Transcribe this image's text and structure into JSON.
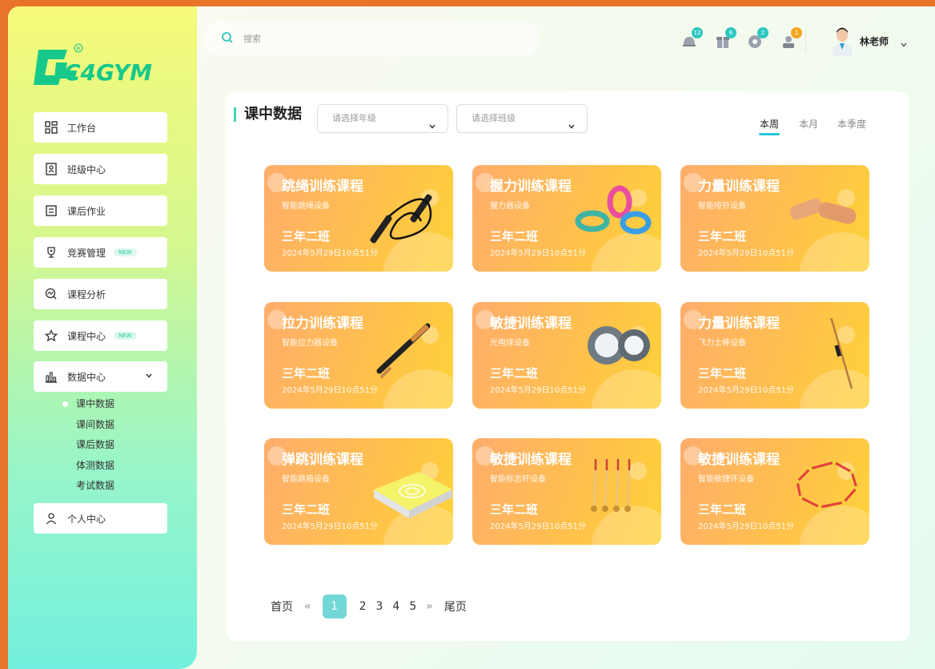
{
  "app": {
    "logo_text": "C4GYM",
    "logo_mark": "®"
  },
  "sidebar": {
    "items": [
      {
        "label": "工作台",
        "icon": "dashboard-icon"
      },
      {
        "label": "班级中心",
        "icon": "class-icon"
      },
      {
        "label": "课后作业",
        "icon": "homework-icon"
      },
      {
        "label": "竞赛管理",
        "icon": "trophy-icon",
        "badge": "NEW"
      },
      {
        "label": "课程分析",
        "icon": "analysis-icon"
      },
      {
        "label": "课程中心",
        "icon": "star-icon",
        "badge": "NEW"
      },
      {
        "label": "数据中心",
        "icon": "bar-chart-icon"
      },
      {
        "label": "个人中心",
        "icon": "user-icon"
      }
    ],
    "data_sub_items": [
      "课中数据",
      "课间数据",
      "课后数据",
      "体测数据",
      "考试数据"
    ]
  },
  "header": {
    "search_placeholder": "搜索",
    "notifications": [
      {
        "icon": "bell-icon",
        "count": "12",
        "color": "#2fc7c0"
      },
      {
        "icon": "gift-icon",
        "count": "8",
        "color": "#2fc7c0"
      },
      {
        "icon": "message-icon",
        "count": "2",
        "color": "#2fc7c0"
      },
      {
        "icon": "team-icon",
        "count": "1",
        "color": "#f5a623"
      }
    ],
    "user_name": "林老师"
  },
  "main": {
    "title": "课中数据",
    "grade_select_placeholder": "请选择年级",
    "class_select_placeholder": "请选择班级",
    "period_tabs": [
      "本周",
      "本月",
      "本季度"
    ],
    "active_period": "本周",
    "cards": [
      {
        "title": "跳绳训练课程",
        "device": "智能跳绳设备",
        "class": "三年二班",
        "time": "2024年5月29日10点51分",
        "icon": "jump-rope-icon"
      },
      {
        "title": "握力训练课程",
        "device": "握力器设备",
        "class": "三年二班",
        "time": "2024年5月29日10点51分",
        "icon": "grip-ring-icon"
      },
      {
        "title": "力量训练课程",
        "device": "智能哑铃设备",
        "class": "三年二班",
        "time": "2024年5月29日10点51分",
        "icon": "foam-roller-icon"
      },
      {
        "title": "拉力训练课程",
        "device": "智能拉力器设备",
        "class": "三年二班",
        "time": "2024年5月29日10点51分",
        "icon": "expander-icon"
      },
      {
        "title": "敏捷训练课程",
        "device": "光电球设备",
        "class": "三年二班",
        "time": "2024年5月29日10点51分",
        "icon": "light-pad-icon"
      },
      {
        "title": "力量训练课程",
        "device": "飞力士棒设备",
        "class": "三年二班",
        "time": "2024年5月29日10点51分",
        "icon": "flexi-bar-icon"
      },
      {
        "title": "弹跳训练课程",
        "device": "智能跳箱设备",
        "class": "三年二班",
        "time": "2024年5月29日10点51分",
        "icon": "jump-box-icon"
      },
      {
        "title": "敏捷训练课程",
        "device": "智能标志杆设备",
        "class": "三年二班",
        "time": "2024年5月29日10点51分",
        "icon": "marker-pole-icon"
      },
      {
        "title": "敏捷训练课程",
        "device": "智能敏捷环设备",
        "class": "三年二班",
        "time": "2024年5月29日10点51分",
        "icon": "agility-ring-icon"
      }
    ],
    "pagination": {
      "first": "首页",
      "prev": "«",
      "pages": [
        "1",
        "2",
        "3",
        "4",
        "5"
      ],
      "current": "1",
      "next": "»",
      "last": "尾页"
    }
  }
}
